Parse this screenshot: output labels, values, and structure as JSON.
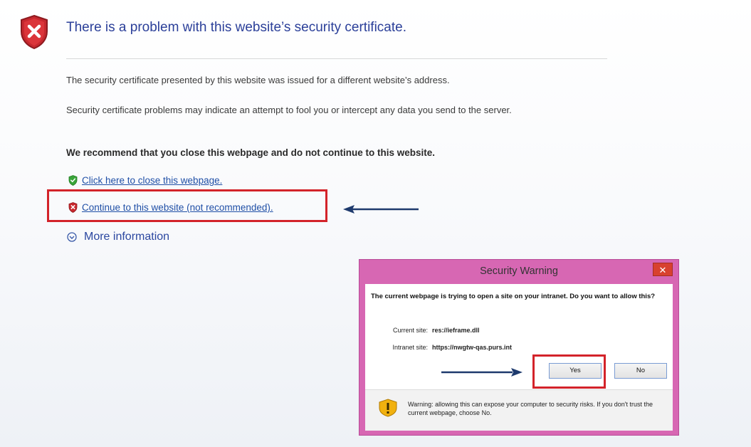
{
  "page": {
    "title": "There is a problem with this website’s security certificate.",
    "paragraph1": "The security certificate presented by this website was issued for a different website’s address.",
    "paragraph2": "Security certificate problems may indicate an attempt to fool you or intercept any data you send to the server.",
    "recommendation": "We recommend that you close this webpage and do not continue to this website.",
    "close_link": "Click here to close this webpage.",
    "continue_link": "Continue to this website (not recommended).",
    "more_info": "More information"
  },
  "dialog": {
    "title": "Security Warning",
    "close_glyph": "✕",
    "question": "The current webpage is trying to open a site on your intranet. Do you want to allow this?",
    "current_site_label": "Current site:",
    "current_site_value": "res://ieframe.dll",
    "intranet_site_label": "Intranet site:",
    "intranet_site_value": "https://nwgtw-qas.purs.int",
    "yes_label": "Yes",
    "no_label": "No",
    "warning_text": "Warning: allowing this can expose your computer to security risks. If you don't trust the current webpage, choose No."
  },
  "colors": {
    "title": "#2b3f99",
    "link": "#1f4fa6",
    "highlight_box": "#d3232a",
    "dialog_frame": "#d767b3",
    "arrow": "#1e3a6d"
  },
  "icons": {
    "header": "shield-x-icon",
    "close_link": "green-shield-icon",
    "continue_link": "red-shield-icon",
    "more_info": "chevron-circle-down-icon",
    "dialog_warning": "warning-shield-icon"
  }
}
